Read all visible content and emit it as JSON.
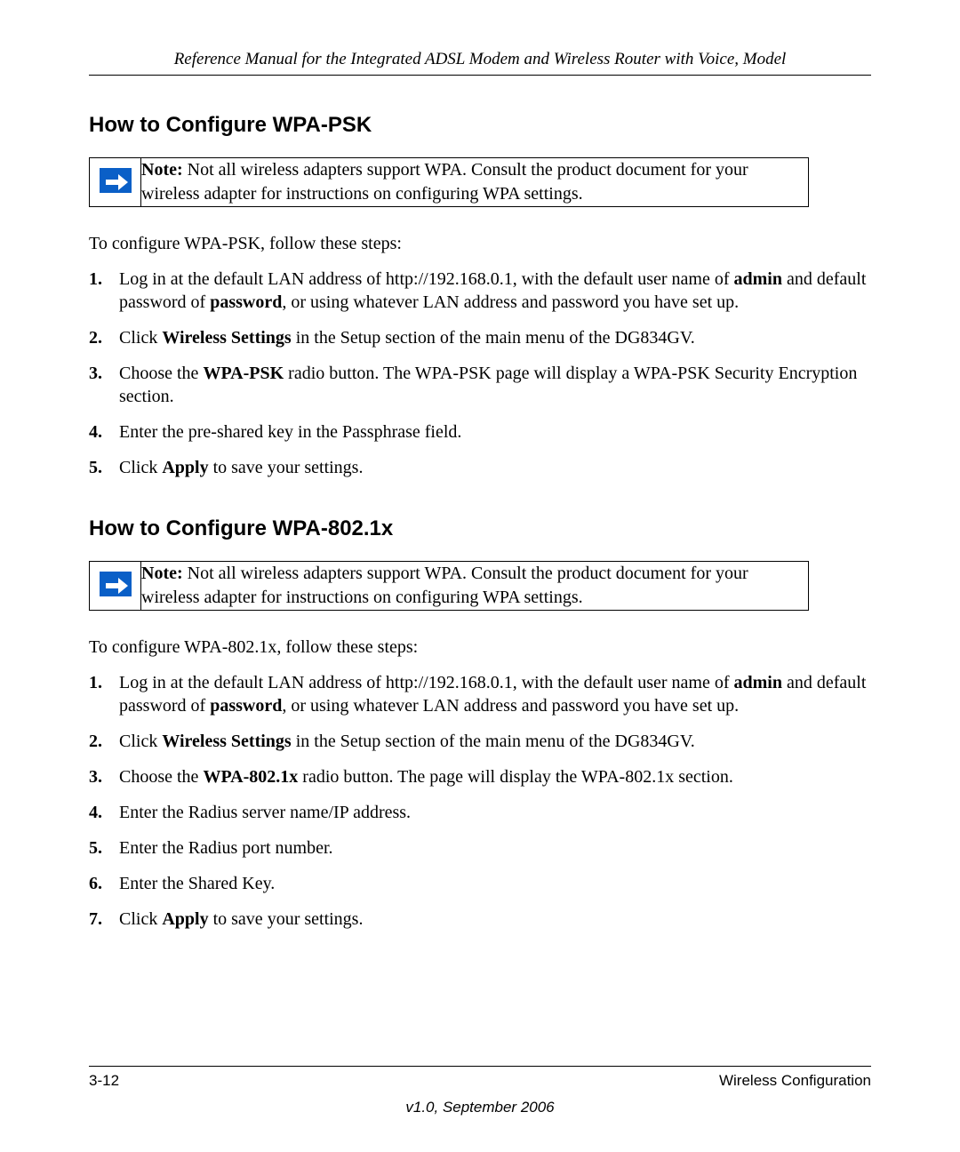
{
  "header": {
    "title": "Reference Manual for the Integrated ADSL Modem and Wireless Router with Voice, Model"
  },
  "section1": {
    "heading": "How to Configure WPA-PSK",
    "note_label": "Note:",
    "note_text": " Not all wireless adapters support WPA. Consult the product document for your wireless adapter for instructions on configuring WPA settings.",
    "intro": "To configure WPA-PSK, follow these steps:",
    "steps": {
      "s1a": "Log in at the default LAN address of http://192.168.0.1, with the default user name of ",
      "s1b": "admin",
      "s1c": " and default password of ",
      "s1d": "password",
      "s1e": ", or using whatever LAN address and password you have set up.",
      "s2a": "Click ",
      "s2b": "Wireless Settings",
      "s2c": " in the Setup section of the main menu of the DG834GV.",
      "s3a": "Choose the ",
      "s3b": "WPA-PSK",
      "s3c": " radio button. The WPA-PSK page will display a WPA-PSK Security Encryption section.",
      "s4": "Enter the pre-shared key in the Passphrase field.",
      "s5a": "Click ",
      "s5b": "Apply",
      "s5c": " to save your settings."
    }
  },
  "section2": {
    "heading": "How to Configure WPA-802.1x",
    "note_label": "Note:",
    "note_text": " Not all wireless adapters support WPA. Consult the product document for your wireless adapter for instructions on configuring WPA settings.",
    "intro": "To configure WPA-802.1x, follow these steps:",
    "steps": {
      "s1a": "Log in at the default LAN address of http://192.168.0.1, with the default user name of ",
      "s1b": "admin",
      "s1c": " and default password of ",
      "s1d": "password",
      "s1e": ", or using whatever LAN address and password you have set up.",
      "s2a": "Click ",
      "s2b": "Wireless Settings",
      "s2c": " in the Setup section of the main menu of the DG834GV.",
      "s3a": "Choose the ",
      "s3b": "WPA-802.1x",
      "s3c": " radio button. The page will display the WPA-802.1x section.",
      "s4": "Enter the Radius server name/IP address.",
      "s5": "Enter the Radius port number.",
      "s6": "Enter the Shared Key.",
      "s7a": "Click ",
      "s7b": "Apply",
      "s7c": " to save your settings."
    }
  },
  "footer": {
    "page": "3-12",
    "section": "Wireless Configuration",
    "version": "v1.0, September 2006"
  }
}
